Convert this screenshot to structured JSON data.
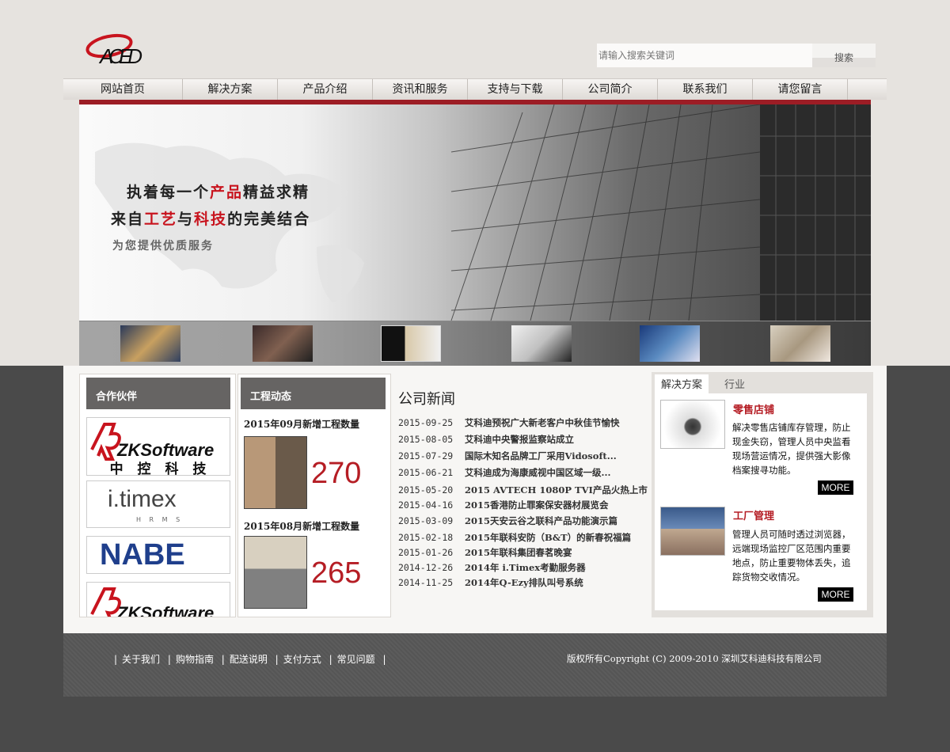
{
  "header": {
    "logo_text": "ACED",
    "search_placeholder": "请输入搜索关键词",
    "search_button": "搜索"
  },
  "nav": [
    {
      "label": "网站首页"
    },
    {
      "label": "解决方案"
    },
    {
      "label": "产品介绍"
    },
    {
      "label": "资讯和服务"
    },
    {
      "label": "支持与下载"
    },
    {
      "label": "公司简介"
    },
    {
      "label": "联系我们"
    },
    {
      "label": "请您留言"
    }
  ],
  "banner": {
    "line1_a": "执着每一个",
    "line1_hl": "产品",
    "line1_b": "精益求精",
    "line2_a": "来自",
    "line2_hl1": "工艺",
    "line2_b": "与",
    "line2_hl2": "科技",
    "line2_c": "的完美结合",
    "line3": "为您提供优质服务"
  },
  "partners": {
    "title": "合作伙伴",
    "items": [
      {
        "name": "ZKSoftware",
        "sub": "中 控 科 技"
      },
      {
        "name": "i.timex",
        "sub": "H R M S"
      },
      {
        "name": "NABE"
      },
      {
        "name": "ZKSoftware"
      }
    ]
  },
  "projects": {
    "title": "工程动态",
    "items": [
      {
        "title": "2015年09月新增工程数量",
        "count": "270"
      },
      {
        "title": "2015年08月新增工程数量",
        "count": "265"
      }
    ]
  },
  "news": {
    "title": "公司新闻",
    "items": [
      {
        "date": "2015-09-25",
        "title": "艾科迪预祝广大新老客户中秋佳节愉快"
      },
      {
        "date": "2015-08-05",
        "title": "艾科迪中央警报监察站成立"
      },
      {
        "date": "2015-07-29",
        "title": "国际木知名品牌工厂采用Vidosoft..."
      },
      {
        "date": "2015-06-21",
        "title": "艾科迪成为海康威视中国区域一级..."
      },
      {
        "date": "2015-05-20",
        "title": "2015 AVTECH 1080P TVI产品火热上市"
      },
      {
        "date": "2015-04-16",
        "title": "2015香港防止罪案保安器材展览会"
      },
      {
        "date": "2015-03-09",
        "title": "2015天安云谷之联科产品功能演示篇"
      },
      {
        "date": "2015-02-18",
        "title": "2015年联科安防（B&T）的新春祝福篇"
      },
      {
        "date": "2015-01-26",
        "title": "2015年联科集团春茗晚宴"
      },
      {
        "date": "2014-12-26",
        "title": "2014年 i.Timex考勤服务器"
      },
      {
        "date": "2014-11-25",
        "title": "2014年Q-Ezy排队叫号系统"
      }
    ]
  },
  "solutions": {
    "tabs": [
      {
        "label": "解决方案"
      },
      {
        "label": "行业"
      }
    ],
    "items": [
      {
        "title": "零售店铺",
        "text": "解决零售店铺库存管理，防止现金失窃，管理人员中央监看现场营运情况，提供强大影像档案搜寻功能。",
        "more": "MORE"
      },
      {
        "title": "工厂管理",
        "text": "管理人员可随时透过浏览器，远端现场监控厂区范围内重要地点，防止重要物体丢失，追踪货物交收情况。",
        "more": "MORE"
      }
    ]
  },
  "footer": {
    "links": [
      {
        "label": "关于我们"
      },
      {
        "label": "购物指南"
      },
      {
        "label": "配送说明"
      },
      {
        "label": "支付方式"
      },
      {
        "label": "常见问题"
      }
    ],
    "separator": "|",
    "copyright": "版权所有Copyright (C) 2009-2010 深圳艾科迪科技有限公司"
  },
  "colors": {
    "brand_red": "#9c1d25",
    "accent_red": "#b51d24",
    "dark_bg": "#4a4a4a"
  }
}
